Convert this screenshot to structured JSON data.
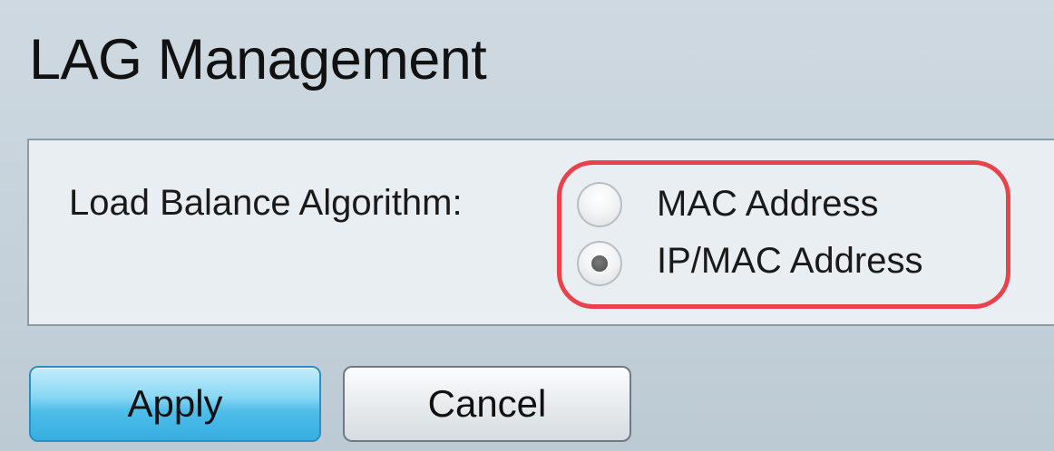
{
  "page": {
    "title": "LAG Management"
  },
  "form": {
    "load_balance_label": "Load Balance Algorithm:",
    "options": [
      {
        "label": "MAC Address",
        "selected": false
      },
      {
        "label": "IP/MAC Address",
        "selected": true
      }
    ]
  },
  "buttons": {
    "apply_label": "Apply",
    "cancel_label": "Cancel"
  },
  "colors": {
    "highlight_annotation": "#e8434c",
    "apply_button": "#4fbde9"
  }
}
